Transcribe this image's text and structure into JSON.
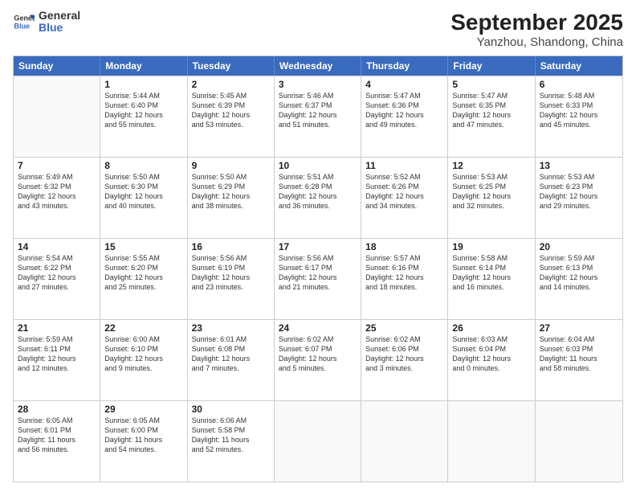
{
  "header": {
    "logo_line1": "General",
    "logo_line2": "Blue",
    "month": "September 2025",
    "location": "Yanzhou, Shandong, China"
  },
  "weekdays": [
    "Sunday",
    "Monday",
    "Tuesday",
    "Wednesday",
    "Thursday",
    "Friday",
    "Saturday"
  ],
  "rows": [
    [
      {
        "day": "",
        "info": ""
      },
      {
        "day": "1",
        "info": "Sunrise: 5:44 AM\nSunset: 6:40 PM\nDaylight: 12 hours\nand 55 minutes."
      },
      {
        "day": "2",
        "info": "Sunrise: 5:45 AM\nSunset: 6:39 PM\nDaylight: 12 hours\nand 53 minutes."
      },
      {
        "day": "3",
        "info": "Sunrise: 5:46 AM\nSunset: 6:37 PM\nDaylight: 12 hours\nand 51 minutes."
      },
      {
        "day": "4",
        "info": "Sunrise: 5:47 AM\nSunset: 6:36 PM\nDaylight: 12 hours\nand 49 minutes."
      },
      {
        "day": "5",
        "info": "Sunrise: 5:47 AM\nSunset: 6:35 PM\nDaylight: 12 hours\nand 47 minutes."
      },
      {
        "day": "6",
        "info": "Sunrise: 5:48 AM\nSunset: 6:33 PM\nDaylight: 12 hours\nand 45 minutes."
      }
    ],
    [
      {
        "day": "7",
        "info": "Sunrise: 5:49 AM\nSunset: 6:32 PM\nDaylight: 12 hours\nand 43 minutes."
      },
      {
        "day": "8",
        "info": "Sunrise: 5:50 AM\nSunset: 6:30 PM\nDaylight: 12 hours\nand 40 minutes."
      },
      {
        "day": "9",
        "info": "Sunrise: 5:50 AM\nSunset: 6:29 PM\nDaylight: 12 hours\nand 38 minutes."
      },
      {
        "day": "10",
        "info": "Sunrise: 5:51 AM\nSunset: 6:28 PM\nDaylight: 12 hours\nand 36 minutes."
      },
      {
        "day": "11",
        "info": "Sunrise: 5:52 AM\nSunset: 6:26 PM\nDaylight: 12 hours\nand 34 minutes."
      },
      {
        "day": "12",
        "info": "Sunrise: 5:53 AM\nSunset: 6:25 PM\nDaylight: 12 hours\nand 32 minutes."
      },
      {
        "day": "13",
        "info": "Sunrise: 5:53 AM\nSunset: 6:23 PM\nDaylight: 12 hours\nand 29 minutes."
      }
    ],
    [
      {
        "day": "14",
        "info": "Sunrise: 5:54 AM\nSunset: 6:22 PM\nDaylight: 12 hours\nand 27 minutes."
      },
      {
        "day": "15",
        "info": "Sunrise: 5:55 AM\nSunset: 6:20 PM\nDaylight: 12 hours\nand 25 minutes."
      },
      {
        "day": "16",
        "info": "Sunrise: 5:56 AM\nSunset: 6:19 PM\nDaylight: 12 hours\nand 23 minutes."
      },
      {
        "day": "17",
        "info": "Sunrise: 5:56 AM\nSunset: 6:17 PM\nDaylight: 12 hours\nand 21 minutes."
      },
      {
        "day": "18",
        "info": "Sunrise: 5:57 AM\nSunset: 6:16 PM\nDaylight: 12 hours\nand 18 minutes."
      },
      {
        "day": "19",
        "info": "Sunrise: 5:58 AM\nSunset: 6:14 PM\nDaylight: 12 hours\nand 16 minutes."
      },
      {
        "day": "20",
        "info": "Sunrise: 5:59 AM\nSunset: 6:13 PM\nDaylight: 12 hours\nand 14 minutes."
      }
    ],
    [
      {
        "day": "21",
        "info": "Sunrise: 5:59 AM\nSunset: 6:11 PM\nDaylight: 12 hours\nand 12 minutes."
      },
      {
        "day": "22",
        "info": "Sunrise: 6:00 AM\nSunset: 6:10 PM\nDaylight: 12 hours\nand 9 minutes."
      },
      {
        "day": "23",
        "info": "Sunrise: 6:01 AM\nSunset: 6:08 PM\nDaylight: 12 hours\nand 7 minutes."
      },
      {
        "day": "24",
        "info": "Sunrise: 6:02 AM\nSunset: 6:07 PM\nDaylight: 12 hours\nand 5 minutes."
      },
      {
        "day": "25",
        "info": "Sunrise: 6:02 AM\nSunset: 6:06 PM\nDaylight: 12 hours\nand 3 minutes."
      },
      {
        "day": "26",
        "info": "Sunrise: 6:03 AM\nSunset: 6:04 PM\nDaylight: 12 hours\nand 0 minutes."
      },
      {
        "day": "27",
        "info": "Sunrise: 6:04 AM\nSunset: 6:03 PM\nDaylight: 11 hours\nand 58 minutes."
      }
    ],
    [
      {
        "day": "28",
        "info": "Sunrise: 6:05 AM\nSunset: 6:01 PM\nDaylight: 11 hours\nand 56 minutes."
      },
      {
        "day": "29",
        "info": "Sunrise: 6:05 AM\nSunset: 6:00 PM\nDaylight: 11 hours\nand 54 minutes."
      },
      {
        "day": "30",
        "info": "Sunrise: 6:06 AM\nSunset: 5:58 PM\nDaylight: 11 hours\nand 52 minutes."
      },
      {
        "day": "",
        "info": ""
      },
      {
        "day": "",
        "info": ""
      },
      {
        "day": "",
        "info": ""
      },
      {
        "day": "",
        "info": ""
      }
    ]
  ]
}
